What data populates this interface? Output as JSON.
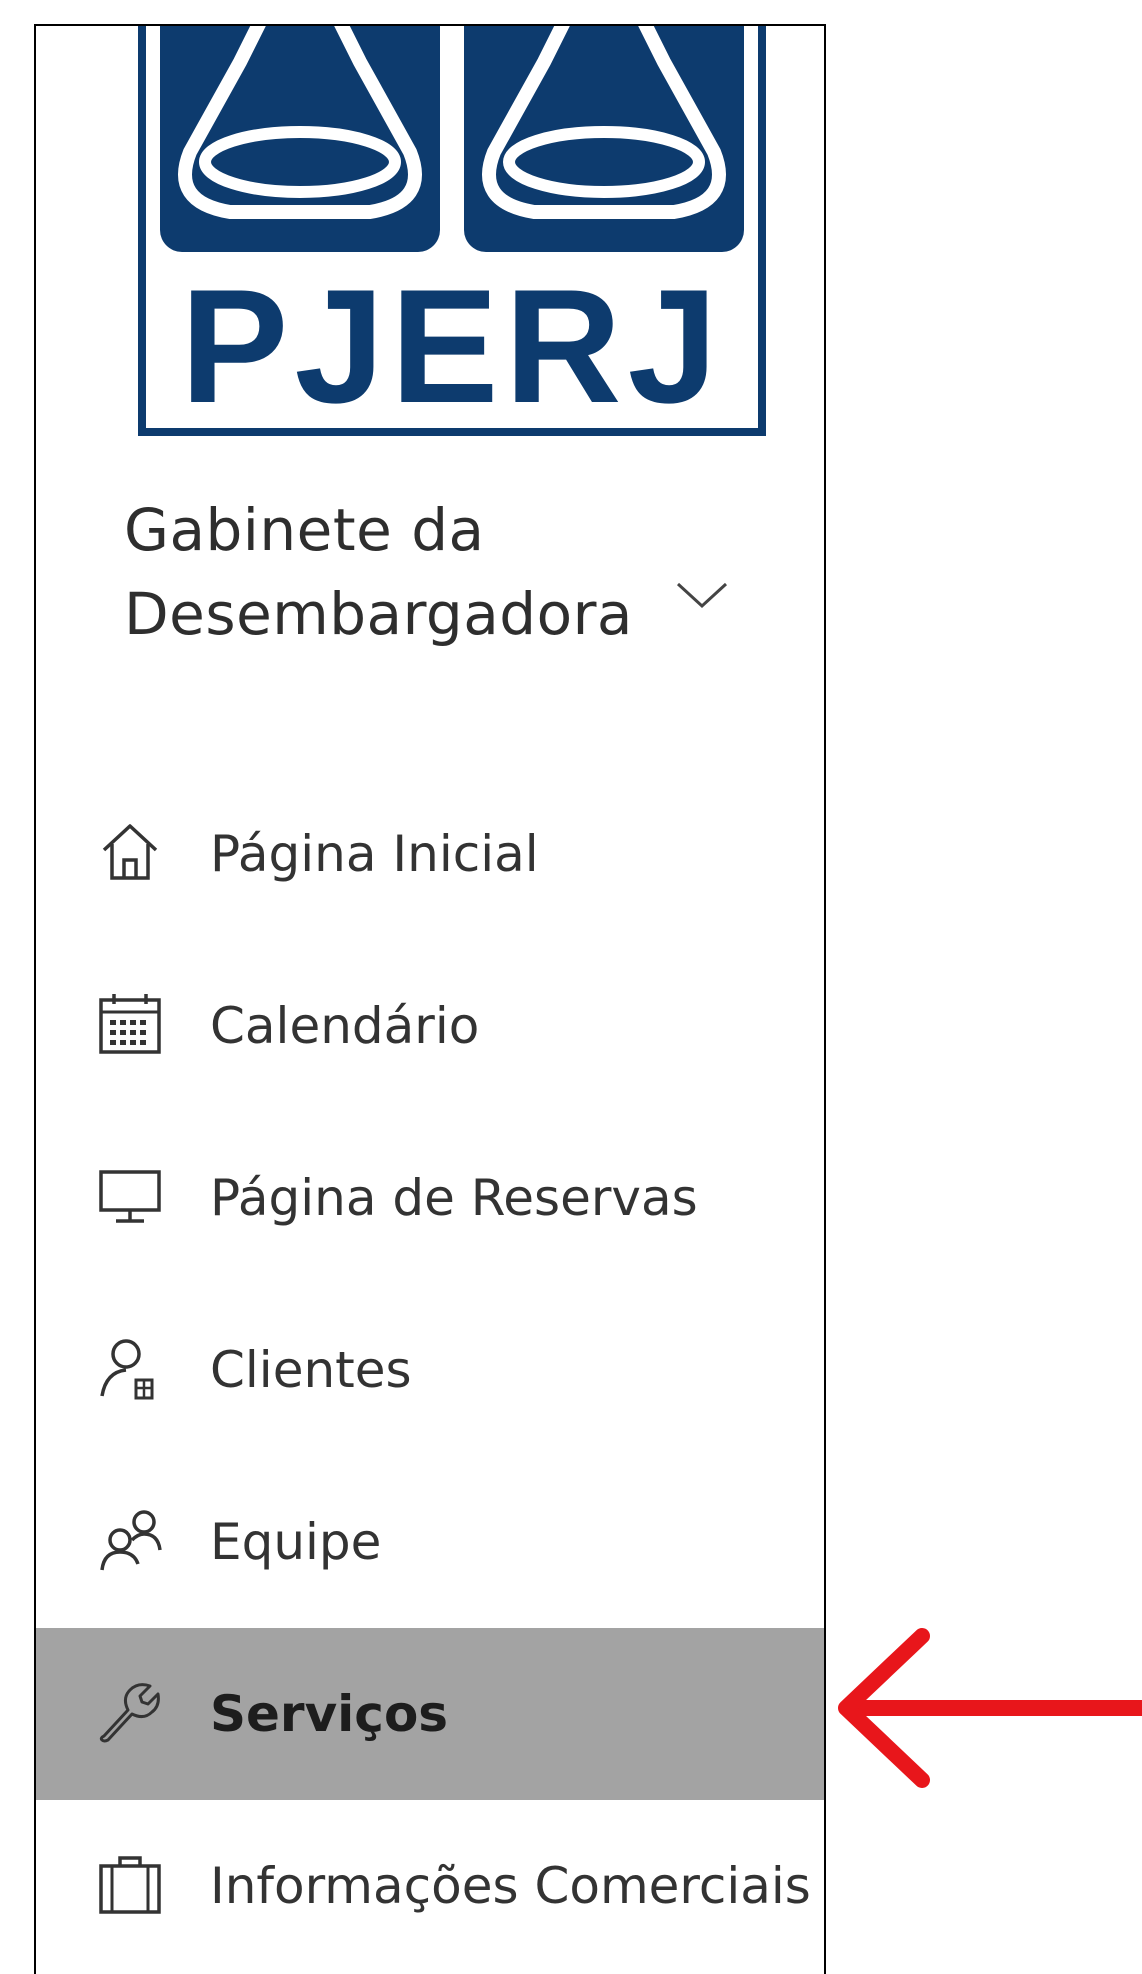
{
  "logo": {
    "text": "PJERJ",
    "color": "#0d3b6e"
  },
  "site": {
    "title_line1": "Gabinete da",
    "title_line2": "Desembargadora"
  },
  "nav": {
    "items": [
      {
        "label": "Página Inicial",
        "icon": "home-icon"
      },
      {
        "label": "Calendário",
        "icon": "calendar-icon"
      },
      {
        "label": "Página de Reservas",
        "icon": "monitor-icon"
      },
      {
        "label": "Clientes",
        "icon": "person-badge-icon"
      },
      {
        "label": "Equipe",
        "icon": "people-icon"
      },
      {
        "label": "Serviços",
        "icon": "wrench-icon",
        "selected": true
      },
      {
        "label": "Informações Comerciais",
        "icon": "briefcase-icon"
      }
    ]
  },
  "colors": {
    "active_bg": "#a3a3a3",
    "arrow": "#e8161b"
  }
}
